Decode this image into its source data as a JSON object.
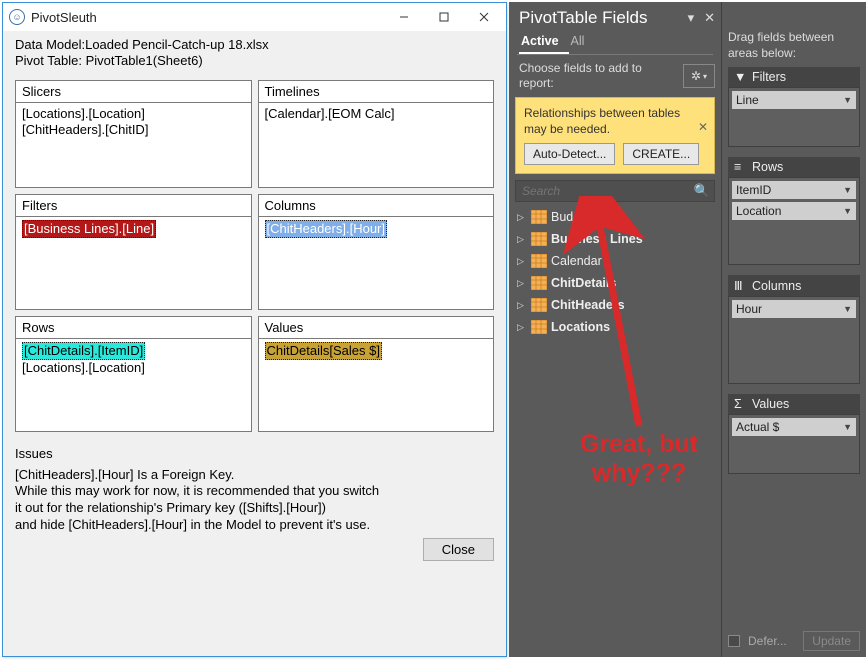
{
  "window": {
    "title": "PivotSleuth",
    "info_line1": "Data Model:Loaded  Pencil-Catch-up 18.xlsx",
    "info_line2": "Pivot Table: PivotTable1(Sheet6)",
    "close_label": "Close"
  },
  "sections": {
    "slicers": {
      "header": "Slicers",
      "lines": [
        "[Locations].[Location]",
        "[ChitHeaders].[ChitID]"
      ]
    },
    "timelines": {
      "header": "Timelines",
      "lines": [
        "[Calendar].[EOM Calc]"
      ]
    },
    "filters": {
      "header": "Filters",
      "hl_text": "[Business Lines].[Line]",
      "hl_class": "hl-red"
    },
    "columns": {
      "header": "Columns",
      "hl_text": "[ChitHeaders].[Hour]",
      "hl_class": "hl-blue"
    },
    "rows": {
      "header": "Rows",
      "hl_text": "[ChitDetails].[ItemID]",
      "hl_class": "hl-cyan",
      "extra_line": "[Locations].[Location]"
    },
    "values": {
      "header": "Values",
      "hl_text": "ChitDetails[Sales $]",
      "hl_class": "hl-gold"
    }
  },
  "issues": {
    "label": "Issues",
    "text": "[ChitHeaders].[Hour] Is a Foreign Key.\nWhile this may work for now, it is recommended that you switch\nit out for the relationship's Primary key ([Shifts].[Hour])\nand hide [ChitHeaders].[Hour] in the Model to prevent it's use."
  },
  "fields_pane": {
    "title": "PivotTable Fields",
    "tabs": {
      "active": "Active",
      "all": "All"
    },
    "choose_text": "Choose fields to add to report:",
    "banner": {
      "msg": "Relationships between tables may be needed.",
      "auto": "Auto-Detect...",
      "create": "CREATE..."
    },
    "search_placeholder": "Search",
    "tables": [
      {
        "label": "Budgets",
        "bold": false
      },
      {
        "label": "Business Lines",
        "bold": true
      },
      {
        "label": "Calendar",
        "bold": false
      },
      {
        "label": "ChitDetails",
        "bold": true
      },
      {
        "label": "ChitHeaders",
        "bold": true
      },
      {
        "label": "Locations",
        "bold": true
      }
    ]
  },
  "zones": {
    "drag_text": "Drag fields between areas below:",
    "filters": {
      "label": "Filters",
      "items": [
        "Line"
      ]
    },
    "rows": {
      "label": "Rows",
      "items": [
        "ItemID",
        "Location"
      ]
    },
    "columns": {
      "label": "Columns",
      "items": [
        "Hour"
      ]
    },
    "values": {
      "label": "Values",
      "items": [
        "Actual $"
      ]
    },
    "defer": "Defer...",
    "update": "Update"
  },
  "annotation": {
    "line1": "Great, but",
    "line2": "why???"
  }
}
